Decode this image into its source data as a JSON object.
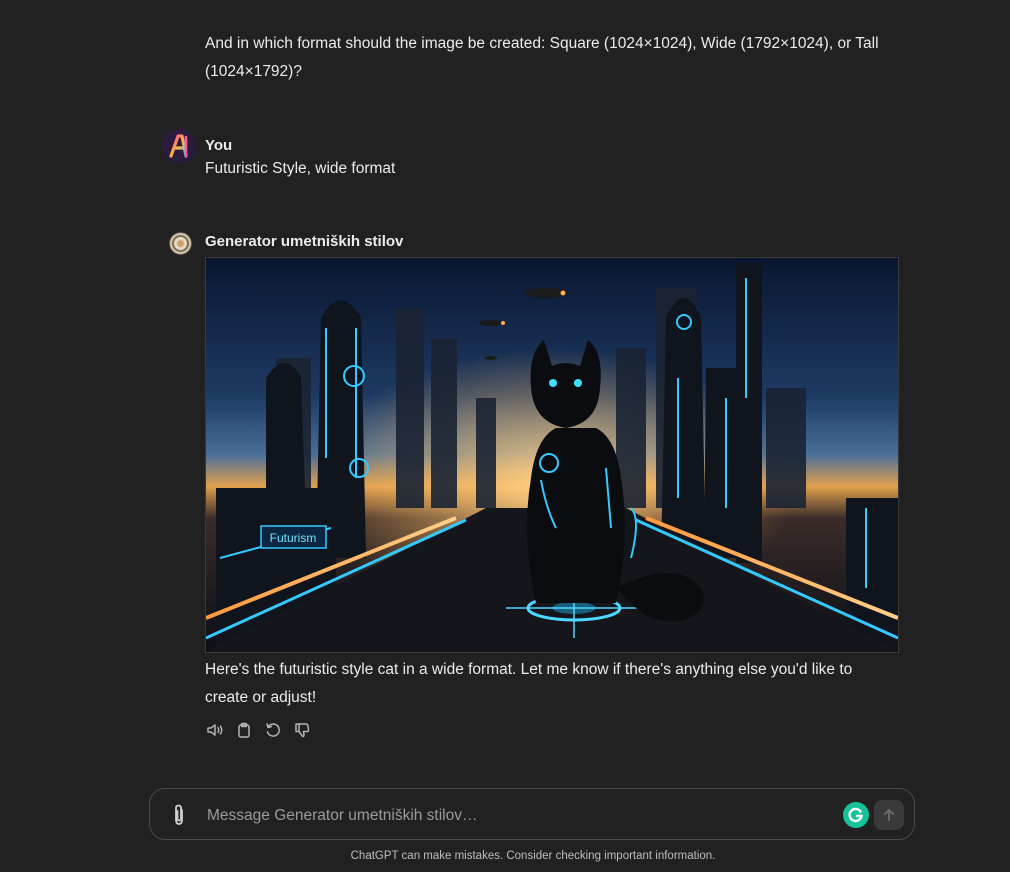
{
  "previous_message": {
    "text": "And in which format should the image be created: Square (1024×1024), Wide (1792×1024), or Tall (1024×1792)?"
  },
  "user_message": {
    "author": "You",
    "text": "Futuristic Style, wide format"
  },
  "assistant_message": {
    "author": "Generator umetniških stilov",
    "image_sign_text": "Futurism",
    "reply": "Here's the futuristic style cat in a wide format. Let me know if there's anything else you'd like to create or adjust!"
  },
  "actions": {
    "icons": [
      "speaker-icon",
      "clipboard-icon",
      "regenerate-icon",
      "thumbs-down-icon"
    ]
  },
  "composer": {
    "placeholder": "Message Generator umetniških stilov…"
  },
  "footer": {
    "disclaimer": "ChatGPT can make mistakes. Consider checking important information."
  },
  "colors": {
    "background": "#212121",
    "text": "#ececec",
    "grammarly": "#15c39a",
    "neon": "#34c9ff"
  }
}
